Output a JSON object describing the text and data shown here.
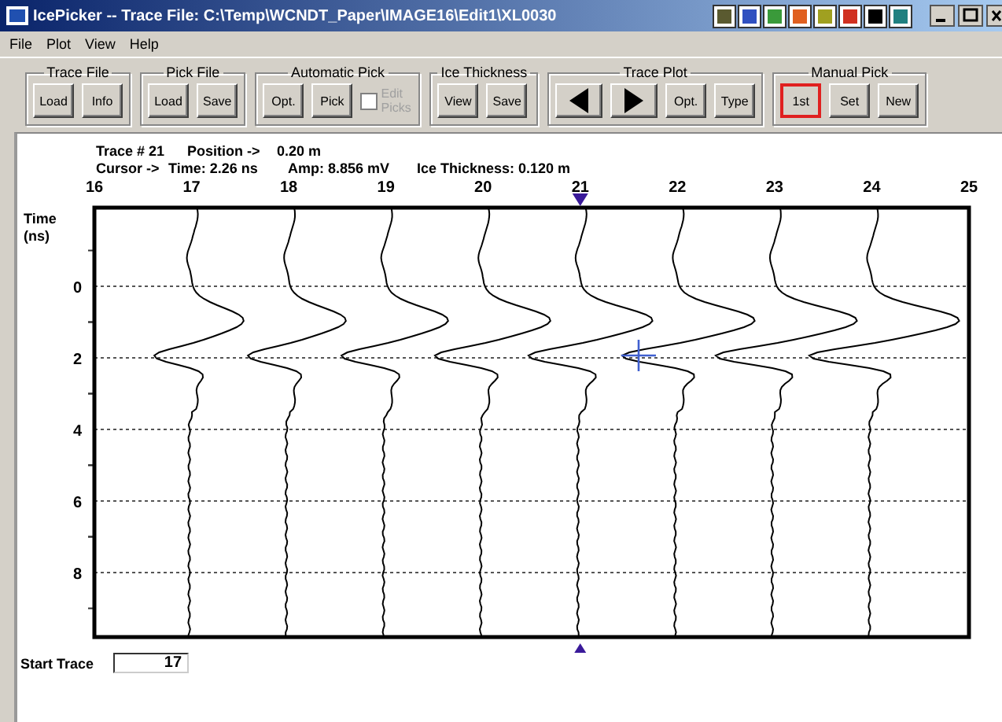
{
  "window": {
    "title": "IcePicker -- Trace File: C:\\Temp\\WCNDT_Paper\\IMAGE16\\Edit1\\XL0030"
  },
  "menu": [
    "File",
    "Plot",
    "View",
    "Help"
  ],
  "groups": [
    {
      "title": "Trace File",
      "controls": [
        {
          "kind": "button",
          "label": "Load"
        },
        {
          "kind": "button",
          "label": "Info"
        }
      ]
    },
    {
      "title": "Pick File",
      "controls": [
        {
          "kind": "button",
          "label": "Load"
        },
        {
          "kind": "button",
          "label": "Save"
        }
      ]
    },
    {
      "title": "Automatic Pick",
      "controls": [
        {
          "kind": "button",
          "label": "Opt."
        },
        {
          "kind": "button",
          "label": "Pick"
        },
        {
          "kind": "checkbox",
          "label": "Edit Picks",
          "checked": false,
          "disabled": true
        }
      ]
    },
    {
      "title": "Ice Thickness",
      "controls": [
        {
          "kind": "button",
          "label": "View"
        },
        {
          "kind": "button",
          "label": "Save"
        }
      ]
    },
    {
      "title": "Trace Plot",
      "controls": [
        {
          "kind": "prev"
        },
        {
          "kind": "next"
        },
        {
          "kind": "button",
          "label": "Opt."
        },
        {
          "kind": "button",
          "label": "Type"
        }
      ]
    },
    {
      "title": "Manual Pick",
      "controls": [
        {
          "kind": "button",
          "label": "1st",
          "selected": true
        },
        {
          "kind": "button",
          "label": "Set",
          "selected": false
        },
        {
          "kind": "button",
          "label": "New",
          "selected": false
        }
      ]
    }
  ],
  "info": {
    "line_1": [
      "Trace # 21",
      "Position ->",
      "0.20 m"
    ],
    "line_2": [
      "Cursor ->",
      "Time: 2.26 ns",
      "Amp: 8.856 mV",
      "Ice Thickness: 0.120 m"
    ]
  },
  "plot": {
    "y_title": [
      "Time",
      "(ns)"
    ],
    "x_labels": [
      {
        "label": "16",
        "selected": false
      },
      {
        "label": "17",
        "selected": false
      },
      {
        "label": "18",
        "selected": false
      },
      {
        "label": "19",
        "selected": false
      },
      {
        "label": "20",
        "selected": false
      },
      {
        "label": "21",
        "selected": true
      },
      {
        "label": "22",
        "selected": false
      },
      {
        "label": "23",
        "selected": false
      },
      {
        "label": "24",
        "selected": false
      },
      {
        "label": "25",
        "selected": false
      }
    ],
    "y_labels": [
      "0",
      "2",
      "4",
      "6",
      "8"
    ]
  },
  "start_trace": {
    "label": "Start Trace",
    "value": "17"
  }
}
